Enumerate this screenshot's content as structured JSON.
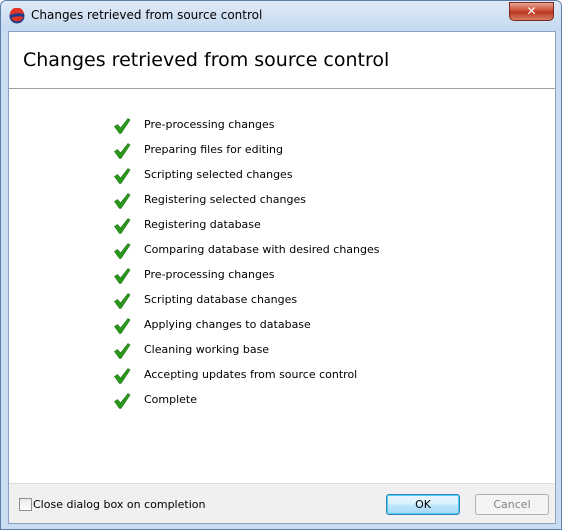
{
  "window": {
    "title": "Changes retrieved from source control",
    "close_glyph": "✕"
  },
  "header": {
    "title": "Changes retrieved from source control"
  },
  "steps": [
    {
      "label": "Pre-processing changes",
      "icon": "check-icon"
    },
    {
      "label": "Preparing files for editing",
      "icon": "check-icon"
    },
    {
      "label": "Scripting selected changes",
      "icon": "check-icon"
    },
    {
      "label": "Registering selected changes",
      "icon": "check-icon"
    },
    {
      "label": "Registering database",
      "icon": "check-icon"
    },
    {
      "label": "Comparing database with desired changes",
      "icon": "check-icon"
    },
    {
      "label": "Pre-processing changes",
      "icon": "check-icon"
    },
    {
      "label": "Scripting database changes",
      "icon": "check-icon"
    },
    {
      "label": "Applying changes to database",
      "icon": "check-icon"
    },
    {
      "label": "Cleaning working base",
      "icon": "check-icon"
    },
    {
      "label": "Accepting updates from source control",
      "icon": "check-icon"
    },
    {
      "label": "Complete",
      "icon": "check-icon"
    }
  ],
  "footer": {
    "close_on_completion_label": "Close dialog box on completion",
    "close_on_completion_checked": false,
    "ok_label": "OK",
    "cancel_label": "Cancel",
    "cancel_enabled": false
  },
  "colors": {
    "check_green": "#2a9a1c",
    "ok_border": "#3c7fb1"
  }
}
